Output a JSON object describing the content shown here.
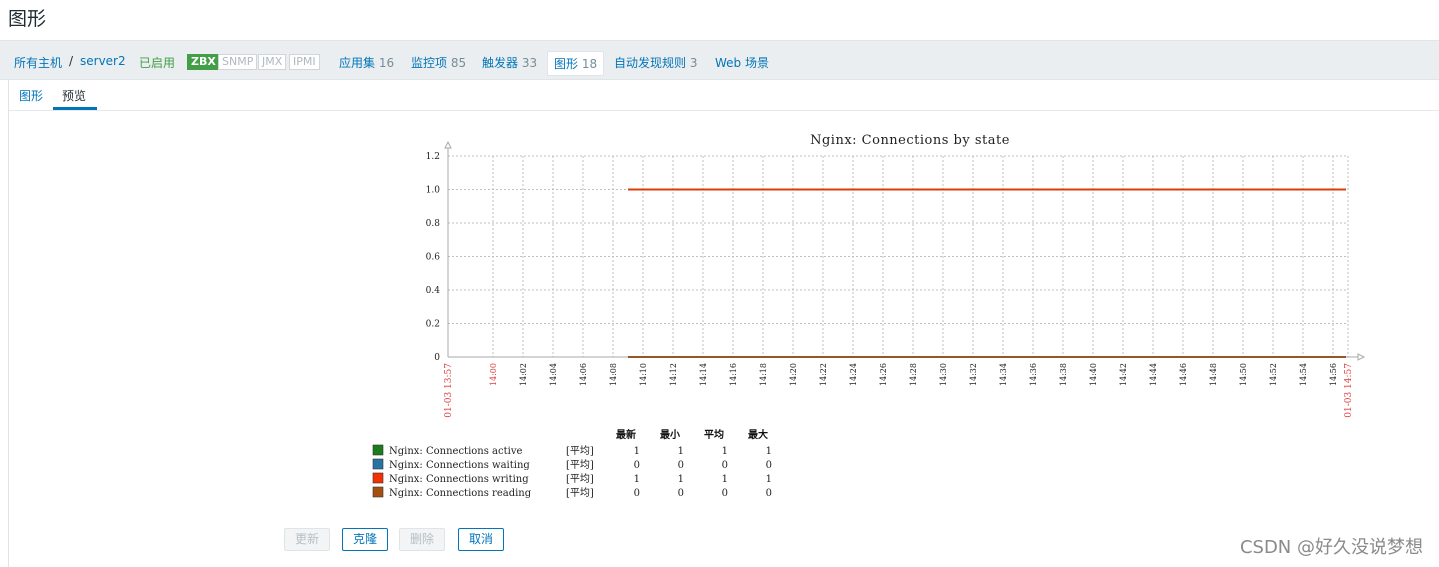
{
  "page_title": "图形",
  "breadcrumb": {
    "all_hosts": "所有主机",
    "separator": "/",
    "host": "server2",
    "status": "已启用",
    "badges": [
      "ZBX",
      "SNMP",
      "JMX",
      "IPMI"
    ],
    "links": [
      {
        "label": "应用集",
        "count": "16"
      },
      {
        "label": "监控项",
        "count": "85"
      },
      {
        "label": "触发器",
        "count": "33"
      },
      {
        "label": "图形",
        "count": "18"
      },
      {
        "label": "自动发现规则",
        "count": "3"
      },
      {
        "label": "Web 场景",
        "count": ""
      }
    ]
  },
  "tabs": [
    "图形",
    "预览"
  ],
  "chart_data": {
    "type": "line",
    "title": "Nginx: Connections by state",
    "ylim": [
      0,
      1.2
    ],
    "y_ticks": [
      "0",
      "0.2",
      "0.4",
      "0.6",
      "0.8",
      "1.0",
      "1.2"
    ],
    "x_start_label": "01-03 13:57",
    "x_end_label": "01-03 14:57",
    "x_ticks": [
      "14:00",
      "14:02",
      "14:04",
      "14:06",
      "14:08",
      "14:10",
      "14:12",
      "14:14",
      "14:16",
      "14:18",
      "14:20",
      "14:22",
      "14:24",
      "14:26",
      "14:28",
      "14:30",
      "14:32",
      "14:34",
      "14:36",
      "14:38",
      "14:40",
      "14:42",
      "14:44",
      "14:46",
      "14:48",
      "14:50",
      "14:52",
      "14:54",
      "14:56"
    ],
    "grid": true,
    "data_start": "14:09",
    "data_end": "14:57",
    "legend_headers": [
      "最新",
      "最小",
      "平均",
      "最大"
    ],
    "series": [
      {
        "name": "Nginx: Connections active",
        "func": "[平均]",
        "color": "#1a7c1a",
        "value": 1,
        "last": "1",
        "min": "1",
        "avg": "1",
        "max": "1"
      },
      {
        "name": "Nginx: Connections waiting",
        "func": "[平均]",
        "color": "#2774a4",
        "value": 0,
        "last": "0",
        "min": "0",
        "avg": "0",
        "max": "0"
      },
      {
        "name": "Nginx: Connections writing",
        "func": "[平均]",
        "color": "#f63100",
        "value": 1,
        "last": "1",
        "min": "1",
        "avg": "1",
        "max": "1"
      },
      {
        "name": "Nginx: Connections reading",
        "func": "[平均]",
        "color": "#a54f10",
        "value": 0,
        "last": "0",
        "min": "0",
        "avg": "0",
        "max": "0"
      }
    ]
  },
  "buttons": {
    "update": "更新",
    "clone": "克隆",
    "delete": "删除",
    "cancel": "取消"
  },
  "watermark": "CSDN @好久没说梦想"
}
